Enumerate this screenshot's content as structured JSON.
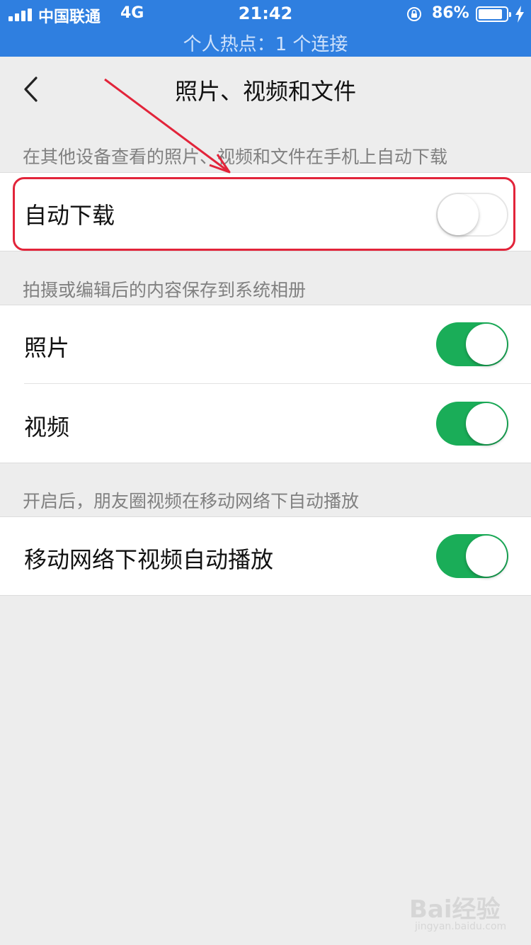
{
  "status_bar": {
    "carrier": "中国联通",
    "network": "4G",
    "time": "21:42",
    "battery_percent": "86%",
    "battery_level": 0.86,
    "hotspot": "个人热点：1 个连接"
  },
  "nav": {
    "title": "照片、视频和文件",
    "back_icon": "chevron-left-icon"
  },
  "sections": [
    {
      "header": "在其他设备查看的照片、视频和文件在手机上自动下载",
      "rows": [
        {
          "label": "自动下载",
          "on": false
        }
      ]
    },
    {
      "header": "拍摄或编辑后的内容保存到系统相册",
      "rows": [
        {
          "label": "照片",
          "on": true
        },
        {
          "label": "视频",
          "on": true
        }
      ]
    },
    {
      "header": "开启后，朋友圈视频在移动网络下自动播放",
      "rows": [
        {
          "label": "移动网络下视频自动播放",
          "on": true
        }
      ]
    }
  ],
  "colors": {
    "status_bar_bg": "#2f7fe0",
    "toggle_on": "#1aad58",
    "annotation_red": "#e2243a"
  },
  "watermark": {
    "brand": "Bai经验",
    "url": "jingyan.baidu.com"
  }
}
